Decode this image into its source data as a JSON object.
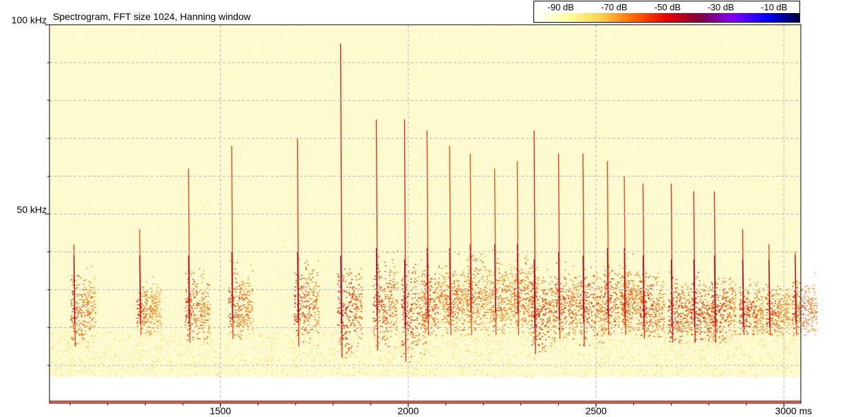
{
  "title": "Spectrogram, FFT size 1024, Hanning window",
  "chart_data": {
    "type": "heatmap",
    "title": "Spectrogram, FFT size 1024, Hanning window",
    "x_unit": "ms",
    "y_unit": "kHz",
    "xlim": [
      1045,
      3045
    ],
    "ylim": [
      0,
      100
    ],
    "x_ticks": [
      {
        "value": 1500,
        "label": "1500"
      },
      {
        "value": 2000,
        "label": "2000"
      },
      {
        "value": 2500,
        "label": "2500"
      },
      {
        "value": 3000,
        "label": "3000 ms"
      }
    ],
    "y_ticks": [
      {
        "value": 100,
        "label": "100 kHz"
      },
      {
        "value": 50,
        "label": "50 kHz"
      }
    ],
    "grid": true,
    "colorbar": {
      "placement": "top-right",
      "ticks": [
        {
          "value": -90,
          "label": "-90 dB"
        },
        {
          "value": -70,
          "label": "-70 dB"
        },
        {
          "value": -50,
          "label": "-50 dB"
        },
        {
          "value": -30,
          "label": "-30 dB"
        },
        {
          "value": -10,
          "label": "-10 dB"
        }
      ],
      "range": [
        -100,
        0
      ],
      "colors": [
        "#ffffff",
        "#ffffa0",
        "#ffd24d",
        "#ff6600",
        "#e60000",
        "#800040",
        "#8000ff",
        "#0000ff",
        "#000040"
      ]
    },
    "noise_floor_khz": 7,
    "calls": [
      {
        "t": 1110,
        "f_low": 15,
        "f_high": 42,
        "f_peak": 25,
        "level_db": -50
      },
      {
        "t": 1285,
        "f_low": 18,
        "f_high": 46,
        "f_peak": 25,
        "level_db": -52
      },
      {
        "t": 1415,
        "f_low": 16,
        "f_high": 62,
        "f_peak": 25,
        "level_db": -50
      },
      {
        "t": 1530,
        "f_low": 17,
        "f_high": 68,
        "f_peak": 26,
        "level_db": -50
      },
      {
        "t": 1705,
        "f_low": 15,
        "f_high": 70,
        "f_peak": 26,
        "level_db": -48
      },
      {
        "t": 1820,
        "f_low": 12,
        "f_high": 95,
        "f_peak": 25,
        "level_db": -45
      },
      {
        "t": 1915,
        "f_low": 14,
        "f_high": 75,
        "f_peak": 27,
        "level_db": -47
      },
      {
        "t": 1990,
        "f_low": 11,
        "f_high": 75,
        "f_peak": 24,
        "level_db": -46
      },
      {
        "t": 2050,
        "f_low": 18,
        "f_high": 72,
        "f_peak": 27,
        "level_db": -50
      },
      {
        "t": 2110,
        "f_low": 18,
        "f_high": 68,
        "f_peak": 27,
        "level_db": -51
      },
      {
        "t": 2165,
        "f_low": 18,
        "f_high": 66,
        "f_peak": 28,
        "level_db": -52
      },
      {
        "t": 2230,
        "f_low": 18,
        "f_high": 62,
        "f_peak": 28,
        "level_db": -52
      },
      {
        "t": 2290,
        "f_low": 18,
        "f_high": 64,
        "f_peak": 28,
        "level_db": -51
      },
      {
        "t": 2335,
        "f_low": 13,
        "f_high": 72,
        "f_peak": 24,
        "level_db": -46
      },
      {
        "t": 2400,
        "f_low": 17,
        "f_high": 66,
        "f_peak": 26,
        "level_db": -49
      },
      {
        "t": 2465,
        "f_low": 15,
        "f_high": 66,
        "f_peak": 25,
        "level_db": -48
      },
      {
        "t": 2530,
        "f_low": 18,
        "f_high": 64,
        "f_peak": 27,
        "level_db": -50
      },
      {
        "t": 2575,
        "f_low": 18,
        "f_high": 60,
        "f_peak": 27,
        "level_db": -51
      },
      {
        "t": 2625,
        "f_low": 17,
        "f_high": 58,
        "f_peak": 25,
        "level_db": -48
      },
      {
        "t": 2700,
        "f_low": 16,
        "f_high": 58,
        "f_peak": 24,
        "level_db": -47
      },
      {
        "t": 2760,
        "f_low": 16,
        "f_high": 56,
        "f_peak": 24,
        "level_db": -46
      },
      {
        "t": 2815,
        "f_low": 16,
        "f_high": 56,
        "f_peak": 25,
        "level_db": -47
      },
      {
        "t": 2890,
        "f_low": 18,
        "f_high": 46,
        "f_peak": 24,
        "level_db": -48
      },
      {
        "t": 2960,
        "f_low": 18,
        "f_high": 42,
        "f_peak": 24,
        "level_db": -50
      },
      {
        "t": 3030,
        "f_low": 18,
        "f_high": 40,
        "f_peak": 25,
        "level_db": -50
      }
    ]
  }
}
